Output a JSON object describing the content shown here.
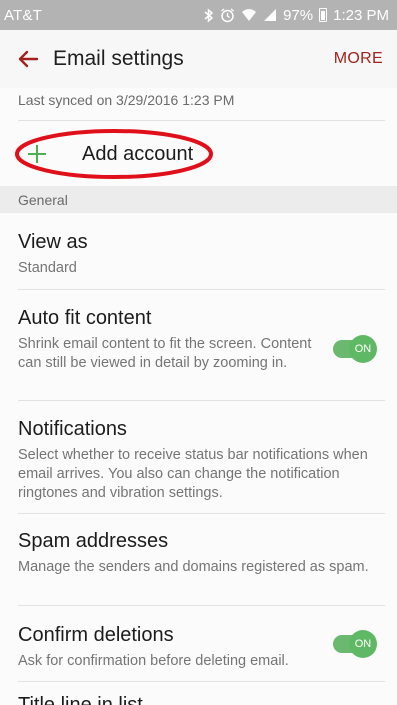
{
  "status_bar": {
    "carrier": "AT&T",
    "battery": "97%",
    "time": "1:23 PM"
  },
  "app_bar": {
    "title": "Email settings",
    "more_label": "MORE"
  },
  "sync": {
    "last_synced": "Last synced on 3/29/2016 1:23 PM"
  },
  "add_account": {
    "label": "Add account"
  },
  "section": {
    "general": "General"
  },
  "settings": {
    "view_as": {
      "title": "View as",
      "desc": "Standard"
    },
    "auto_fit": {
      "title": "Auto fit content",
      "desc": "Shrink email content to fit the screen. Content can still be viewed in detail by zooming in.",
      "toggle": "ON"
    },
    "notifications": {
      "title": "Notifications",
      "desc": "Select whether to receive status bar notifications when email arrives. You also can change the notification ringtones and vibration settings."
    },
    "spam": {
      "title": "Spam addresses",
      "desc": "Manage the senders and domains registered as spam."
    },
    "confirm_deletions": {
      "title": "Confirm deletions",
      "desc": "Ask for confirmation before deleting email.",
      "toggle": "ON"
    },
    "title_line": {
      "title": "Title line in list"
    }
  },
  "colors": {
    "accent": "#a1231c",
    "toggle_on": "#5fb964",
    "annotation_ring": "#e0101a"
  },
  "icons": [
    "back-arrow-icon",
    "bluetooth-icon",
    "alarm-icon",
    "wifi-icon",
    "signal-icon",
    "battery-icon",
    "plus-icon"
  ]
}
